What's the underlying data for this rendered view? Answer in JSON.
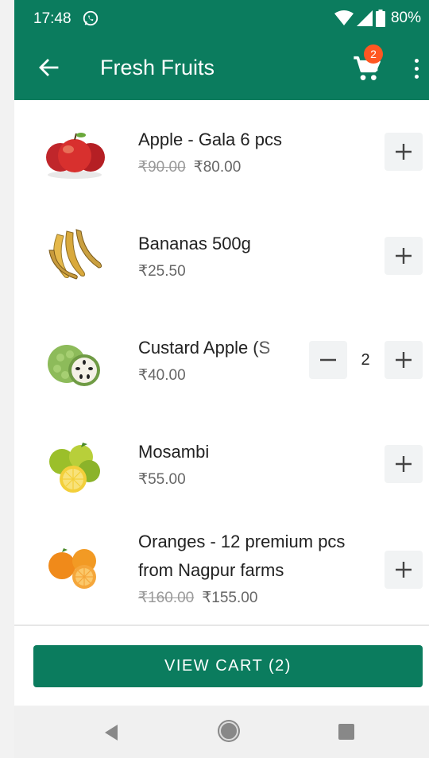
{
  "status_bar": {
    "time": "17:48",
    "battery": "80%",
    "icons": [
      "whatsapp-icon",
      "wifi-icon",
      "signal-icon",
      "battery-icon"
    ]
  },
  "toolbar": {
    "title": "Fresh Fruits",
    "cart_count": "2",
    "colors": {
      "primary": "#0b7c5e",
      "badge": "#ff5722"
    }
  },
  "products": [
    {
      "name": "Apple - Gala 6 pcs",
      "old_price": "₹90.00",
      "price": "₹80.00",
      "icon": "apple-image"
    },
    {
      "name": "Bananas 500g",
      "old_price": "",
      "price": "₹25.50",
      "icon": "banana-image"
    },
    {
      "name": "Custard Apple (S",
      "old_price": "",
      "price": "₹40.00",
      "quantity": "2",
      "icon": "custard-apple-image"
    },
    {
      "name": "Mosambi",
      "old_price": "",
      "price": "₹55.00",
      "icon": "mosambi-image"
    },
    {
      "name_line1": "Oranges - 12 premium pcs",
      "name_line2": "from Nagpur farms",
      "old_price": "₹160.00",
      "price": "₹155.00",
      "icon": "orange-image"
    }
  ],
  "footer": {
    "view_cart_label": "VIEW CART (2)"
  }
}
